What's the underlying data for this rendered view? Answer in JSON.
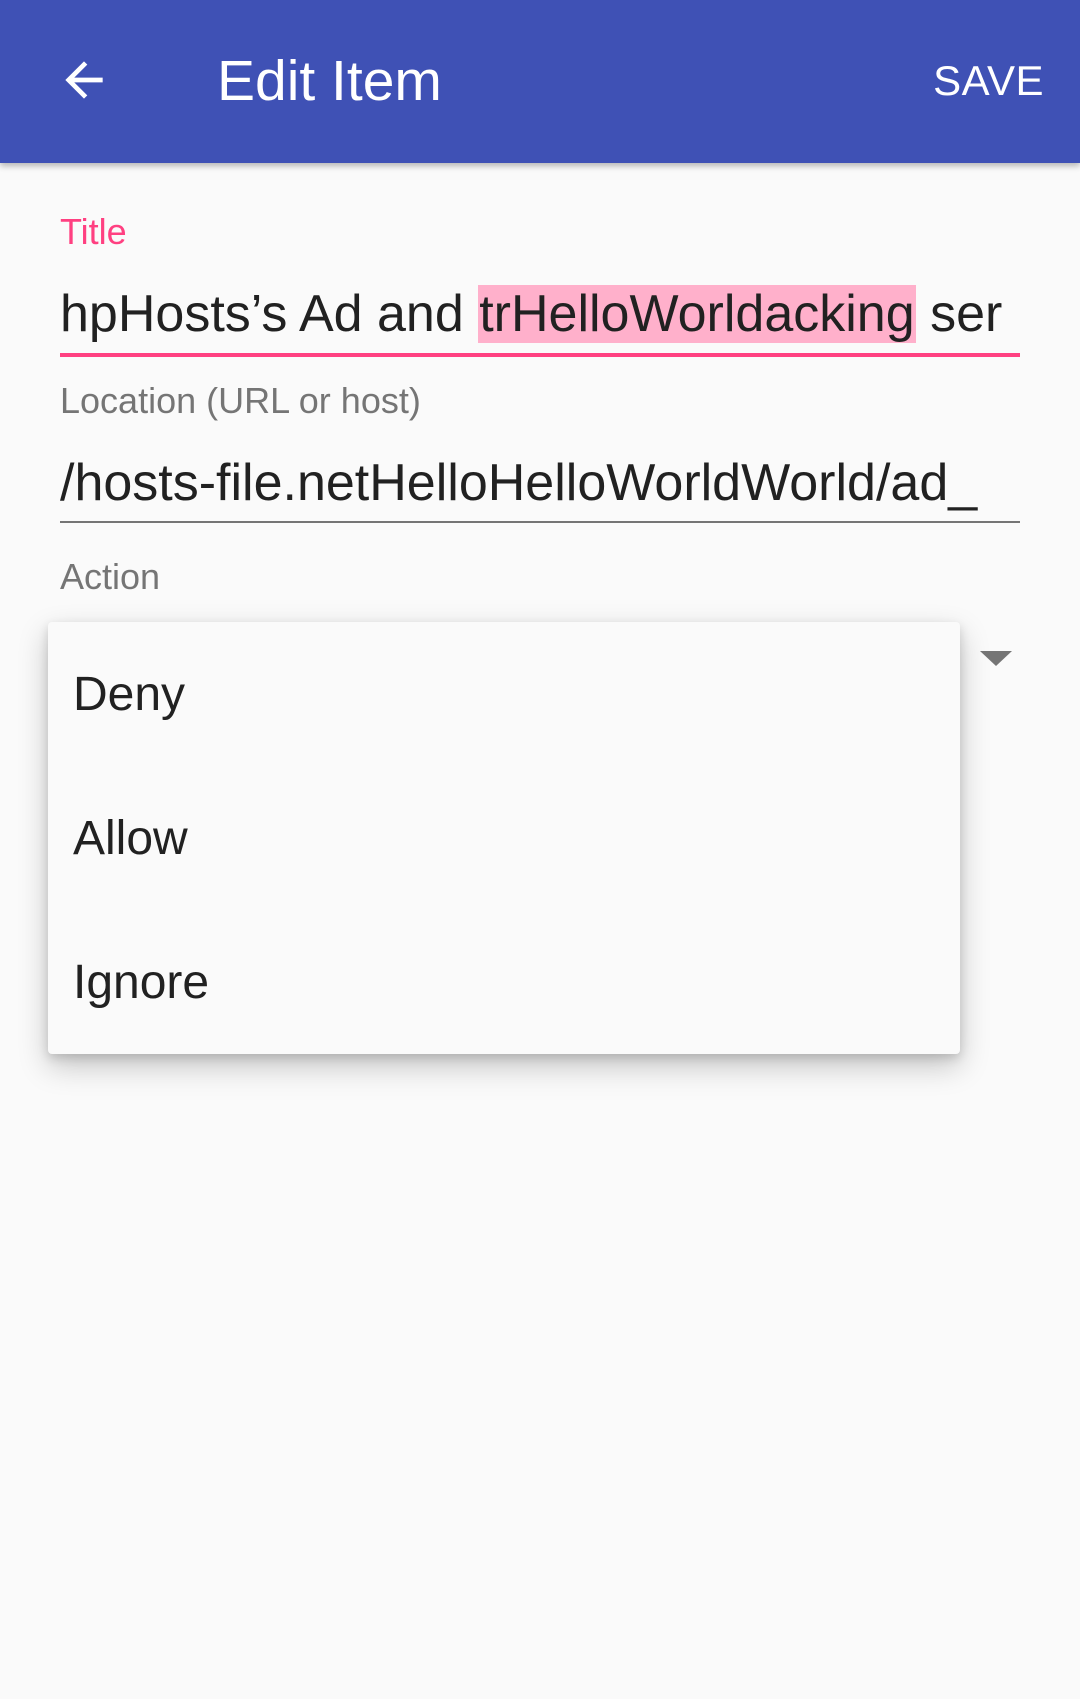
{
  "appbar": {
    "title": "Edit Item",
    "back_icon": "arrow-left-icon",
    "save_label": "SAVE",
    "color": "#3f51b5"
  },
  "form": {
    "title_label": "Title",
    "title_value_before": "hpHosts’s Ad and ",
    "title_value_selected": "trHelloWorldacking",
    "title_value_after": " ser",
    "location_label": "Location (URL or host)",
    "location_value": "/hosts-file.netHelloHelloWorldWorld/ad_",
    "action_label": "Action"
  },
  "action_menu": {
    "options": [
      "Deny",
      "Allow",
      "Ignore"
    ],
    "arrow_icon": "dropdown-arrow-icon"
  },
  "colors": {
    "accent": "#ff4081",
    "selection": "#ffb0cb",
    "label_gray": "#757575",
    "text": "#212121"
  }
}
